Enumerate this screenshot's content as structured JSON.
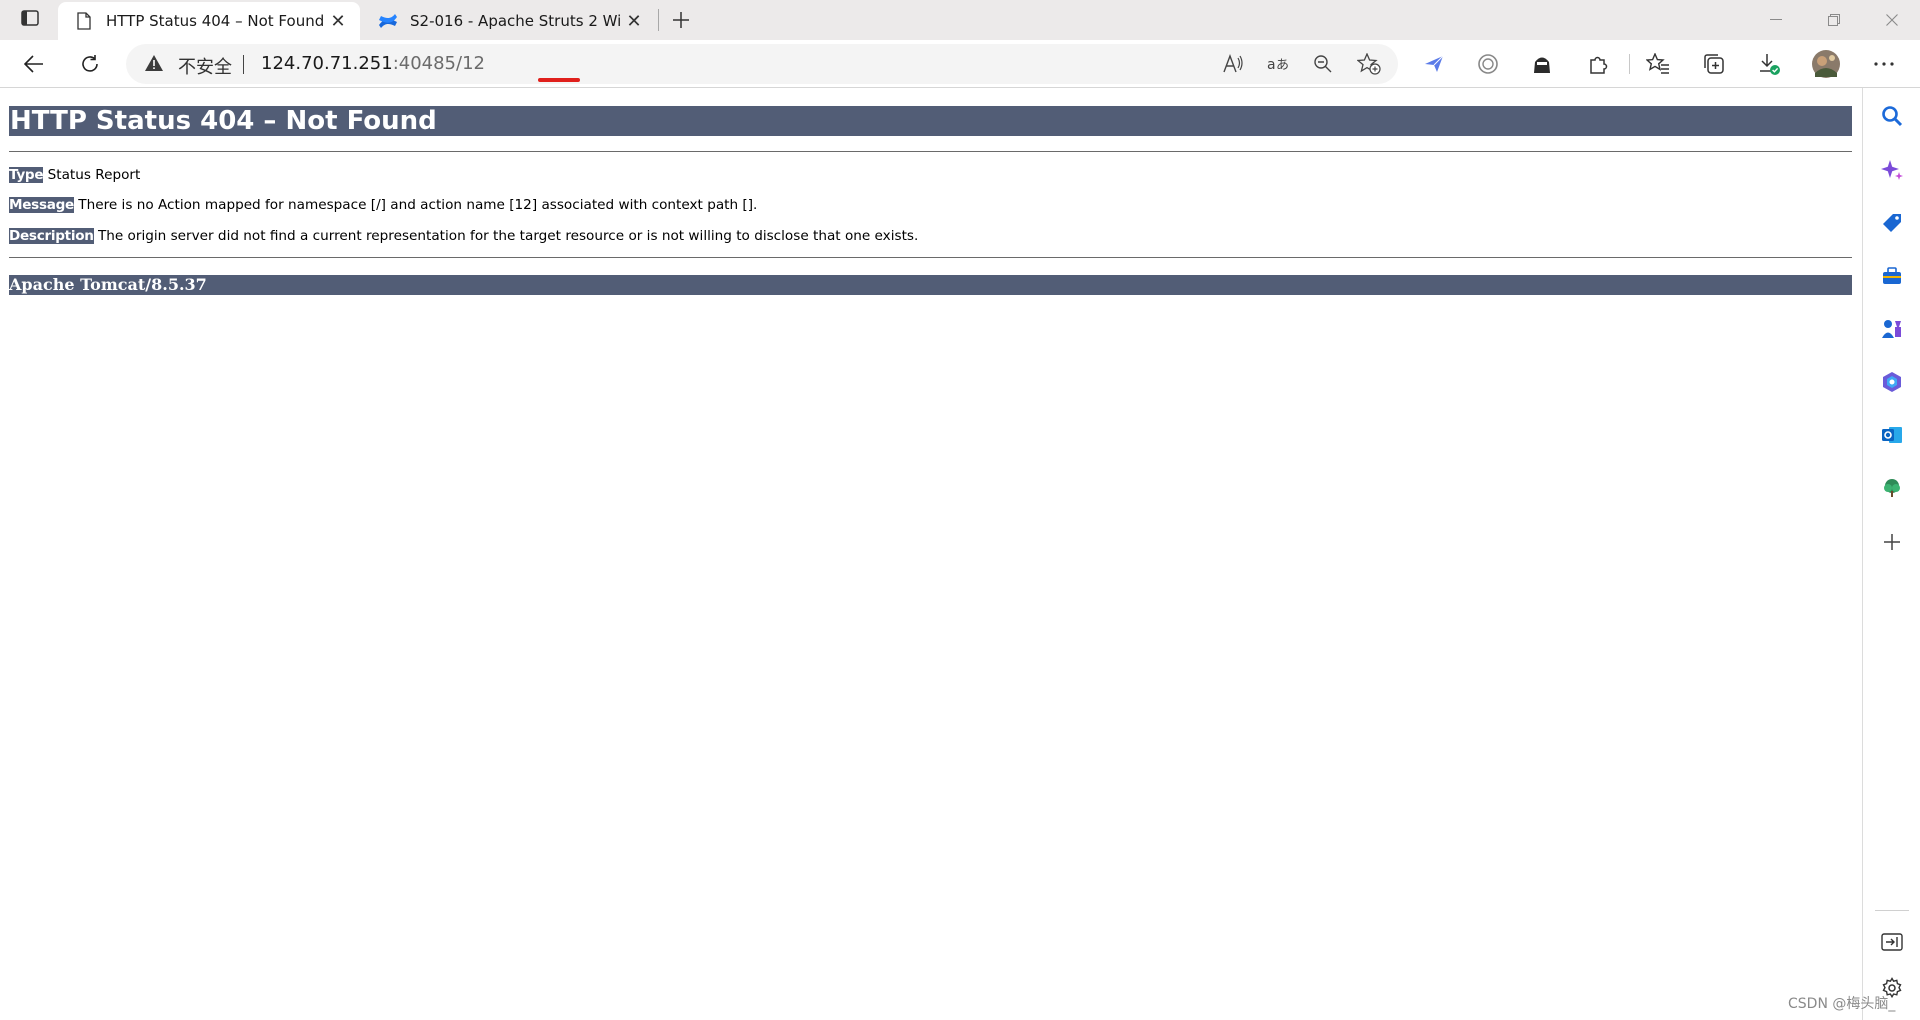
{
  "browser": {
    "tabs": [
      {
        "title": "HTTP Status 404 – Not Found",
        "favicon": "page-icon",
        "active": true
      },
      {
        "title": "S2-016 - Apache Struts 2 Wiki - A",
        "favicon": "confluence-icon",
        "active": false
      }
    ],
    "address_bar": {
      "security_label": "不安全",
      "url_host": "124.70.71.251",
      "url_rest": ":40485/12"
    },
    "toolbar_icons": [
      "read-aloud-icon",
      "translate-icon",
      "zoom-out-icon",
      "add-favorite-icon",
      "extension-bird-icon",
      "extension-circle-icon",
      "extension-agent-icon",
      "extensions-icon",
      "favorites-icon",
      "collections-icon",
      "downloads-icon",
      "profile-avatar",
      "more-icon"
    ],
    "sidebar_icons": [
      "search-icon",
      "copilot-icon",
      "shopping-tag-icon",
      "tools-icon",
      "games-icon",
      "office-icon",
      "outlook-icon",
      "tree-icon",
      "add-icon",
      "hide-sidebar-icon",
      "settings-icon"
    ]
  },
  "error_page": {
    "heading": "HTTP Status 404 – Not Found",
    "type_label": "Type",
    "type_value": "Status Report",
    "message_label": "Message",
    "message_value": "There is no Action mapped for namespace [/] and action name [12] associated with context path [].",
    "description_label": "Description",
    "description_value": "The origin server did not find a current representation for the target resource or is not willing to disclose that one exists.",
    "server_footer": "Apache Tomcat/8.5.37"
  },
  "watermark": "CSDN @梅头脑_",
  "colors": {
    "tomcat_header_bg": "#525d76",
    "url_underline": "#e0201c",
    "tab_strip_bg": "#eceaea"
  }
}
